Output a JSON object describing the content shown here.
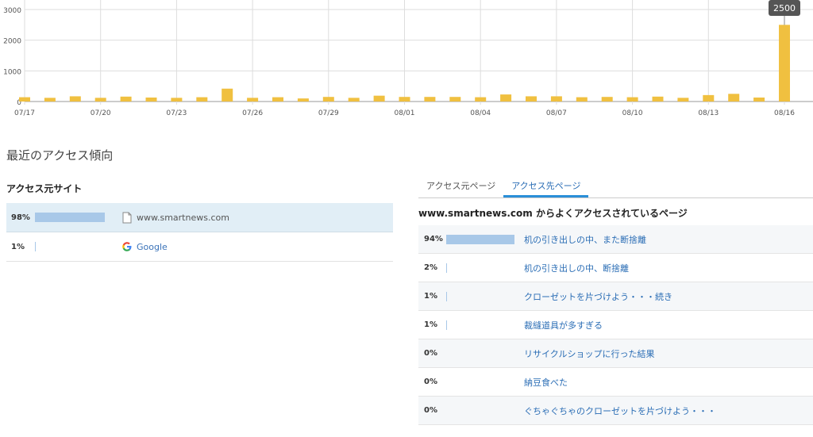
{
  "chart_data": {
    "type": "bar",
    "categories": [
      "07/17",
      "07/18",
      "07/19",
      "07/20",
      "07/21",
      "07/22",
      "07/23",
      "07/24",
      "07/25",
      "07/26",
      "07/27",
      "07/28",
      "07/29",
      "07/30",
      "07/31",
      "08/01",
      "08/02",
      "08/03",
      "08/04",
      "08/05",
      "08/06",
      "08/07",
      "08/08",
      "08/09",
      "08/10",
      "08/11",
      "08/12",
      "08/13",
      "08/14",
      "08/15",
      "08/16"
    ],
    "tick_labels": [
      "07/17",
      "07/20",
      "07/23",
      "07/26",
      "07/29",
      "08/01",
      "08/04",
      "08/07",
      "08/10",
      "08/13",
      "08/16"
    ],
    "values": [
      140,
      120,
      170,
      120,
      160,
      130,
      120,
      140,
      420,
      120,
      140,
      100,
      150,
      120,
      190,
      150,
      150,
      150,
      140,
      230,
      170,
      170,
      140,
      150,
      140,
      160,
      120,
      210,
      250,
      130,
      2500
    ],
    "ylim": [
      0,
      3100
    ],
    "yticks": [
      0,
      1000,
      2000,
      3000
    ],
    "grid": true,
    "bar_color": "#f0c040",
    "tooltip": {
      "label": "2500"
    }
  },
  "section_title": "最近のアクセス傾向",
  "sources": {
    "title": "アクセス元サイト",
    "rows": [
      {
        "pct": "98%",
        "fraction": 0.98,
        "icon": "document-icon",
        "label": "www.smartnews.com",
        "link": false
      },
      {
        "pct": "1%",
        "fraction": 0.01,
        "icon": "google-icon",
        "label": "Google",
        "link": true
      }
    ]
  },
  "destinations": {
    "tabs": [
      {
        "label": "アクセス元ページ",
        "active": false
      },
      {
        "label": "アクセス先ページ",
        "active": true
      }
    ],
    "title": "www.smartnews.com からよくアクセスされているページ",
    "rows": [
      {
        "pct": "94%",
        "fraction": 0.94,
        "label": "机の引き出しの中、また断捨離"
      },
      {
        "pct": "2%",
        "fraction": 0.02,
        "label": "机の引き出しの中、断捨離"
      },
      {
        "pct": "1%",
        "fraction": 0.01,
        "label": "クローゼットを片づけよう・・・続き"
      },
      {
        "pct": "1%",
        "fraction": 0.01,
        "label": "裁縫道具が多すぎる"
      },
      {
        "pct": "0%",
        "fraction": 0,
        "label": "リサイクルショップに行った結果"
      },
      {
        "pct": "0%",
        "fraction": 0,
        "label": "納豆食べた"
      },
      {
        "pct": "0%",
        "fraction": 0,
        "label": "ぐちゃぐちゃのクローゼットを片づけよう・・・"
      }
    ]
  }
}
